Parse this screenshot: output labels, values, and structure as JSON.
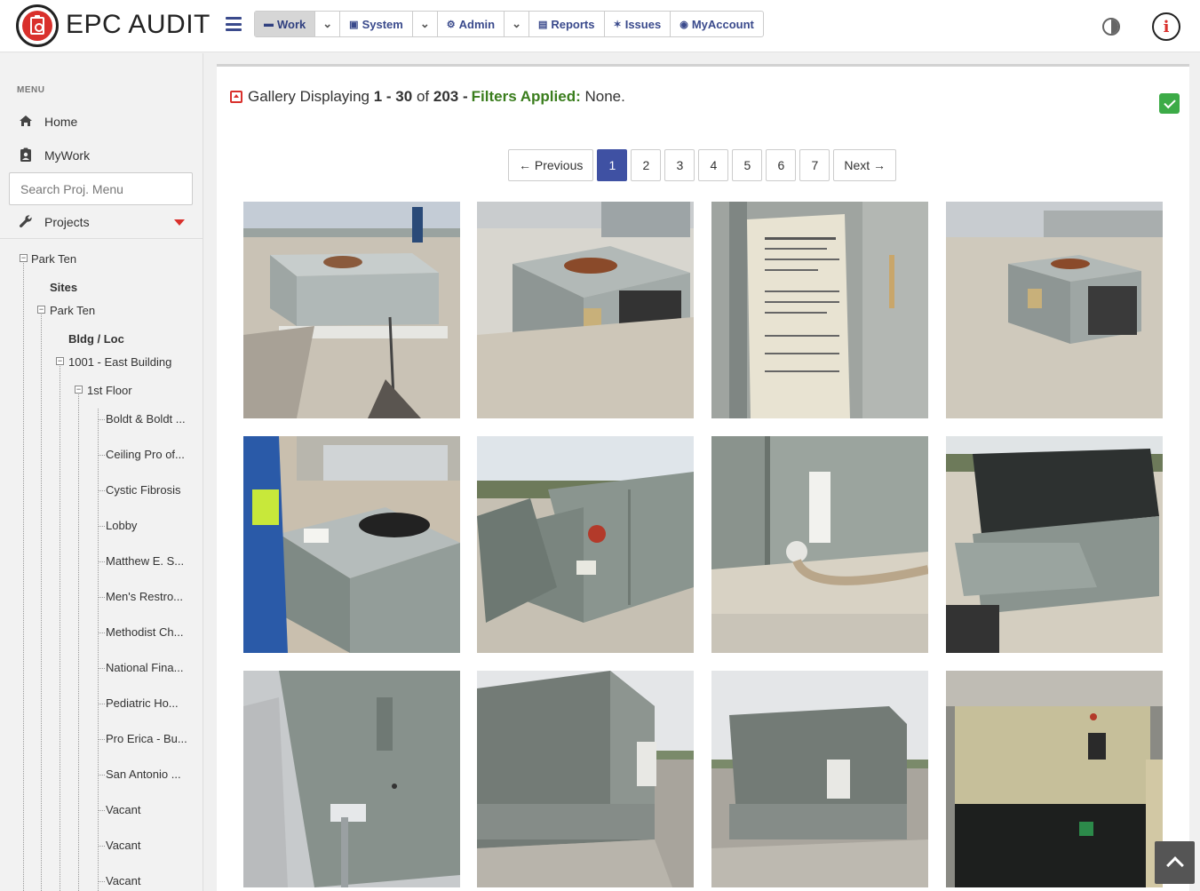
{
  "header": {
    "brand": "EPC AUDIT",
    "nav": [
      {
        "label": "Work",
        "icon": "folder-icon",
        "glyph": "▬"
      },
      {
        "label": "System",
        "icon": "lock-icon",
        "glyph": "▣"
      },
      {
        "label": "Admin",
        "icon": "gears-icon",
        "glyph": "⚙"
      },
      {
        "label": "Reports",
        "icon": "copy-icon",
        "glyph": "▤"
      },
      {
        "label": "Issues",
        "icon": "bug-icon",
        "glyph": "✶"
      },
      {
        "label": "MyAccount",
        "icon": "user-circle-icon",
        "glyph": "◉"
      }
    ],
    "caret": "⌄",
    "info": "i"
  },
  "sidebar": {
    "menu_label": "MENU",
    "home": "Home",
    "mywork": "MyWork",
    "search_placeholder": "Search Proj. Menu",
    "projects": "Projects",
    "tree": {
      "root": "Park Ten",
      "sites_label": "Sites",
      "site": "Park Ten",
      "bldg_label": "Bldg / Loc",
      "building": "1001 - East Building",
      "floor": "1st Floor",
      "rooms": [
        "Boldt & Boldt ...",
        "Ceiling Pro of...",
        "Cystic Fibrosis",
        "Lobby",
        "Matthew E. S...",
        "Men's Restro...",
        "Methodist Ch...",
        "National Fina...",
        "Pediatric Ho...",
        "Pro Erica - Bu...",
        "San Antonio ...",
        "Vacant",
        "Vacant",
        "Vacant"
      ]
    }
  },
  "gallery": {
    "prefix": "Gallery Displaying",
    "range": "1 - 30",
    "of_word": "of",
    "total": "203",
    "dash": "-",
    "filters_label": "Filters Applied:",
    "filters_value": "None."
  },
  "pagination": {
    "previous": "← Previous",
    "pages": [
      "1",
      "2",
      "3",
      "4",
      "5",
      "6",
      "7"
    ],
    "current": "1",
    "next": "Next →"
  },
  "photos": [
    "rooftop-unit-photo",
    "rooftop-unit-photo",
    "nameplate-photo",
    "rooftop-unit-photo",
    "technician-inspecting-unit-photo",
    "trane-rooftop-unit-photo",
    "unit-panel-closeup-photo",
    "rooftop-unit-photo",
    "unit-side-closeup-photo",
    "large-rooftop-unit-photo",
    "large-rooftop-unit-photo",
    "indoor-air-handler-photo"
  ],
  "colors": {
    "brand_red": "#d9302c",
    "nav_blue": "#3a4a8c",
    "active_page": "#3f51a3",
    "filters_green": "#3a7d1d",
    "check_green": "#3cab47"
  }
}
